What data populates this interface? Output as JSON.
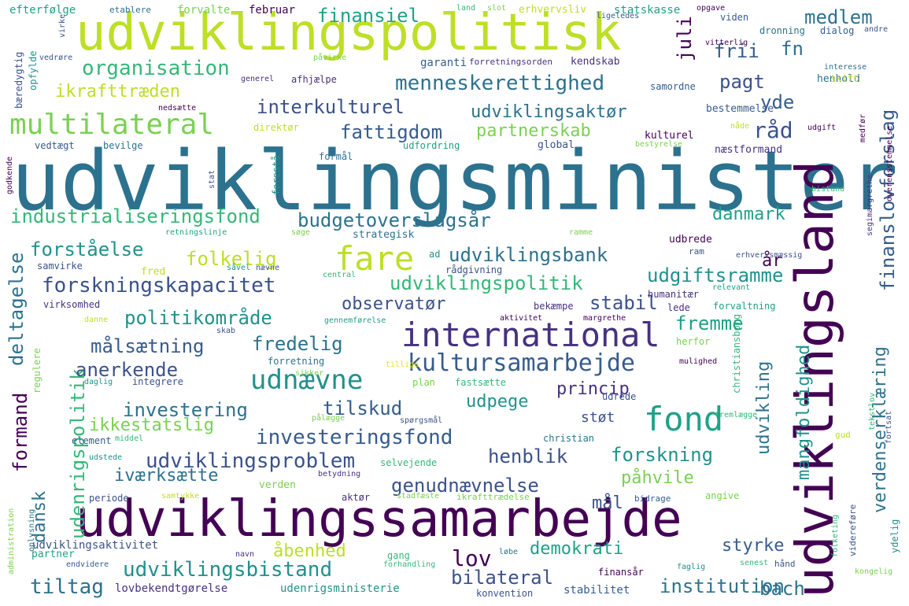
{
  "palette": {
    "dark-purple": "#440154",
    "indigo": "#46327e",
    "blue": "#365c8d",
    "steel": "#3b528b",
    "teal-blue": "#2c728e",
    "teal": "#21918c",
    "sea-green": "#1fa187",
    "green": "#35b779",
    "lime": "#7ad151",
    "yellow-green": "#bddf26",
    "yellow": "#e2e418"
  },
  "words": [
    {
      "text": "udviklingsminister"
    },
    {
      "text": "udviklingssamarbejde"
    },
    {
      "text": "udviklingsland"
    },
    {
      "text": "udviklingspolitisk"
    },
    {
      "text": "international"
    },
    {
      "text": "fond"
    },
    {
      "text": "fare"
    },
    {
      "text": "multilateral"
    },
    {
      "text": "kultursamarbejde"
    },
    {
      "text": "udnævne"
    },
    {
      "text": "finanslovforslag"
    },
    {
      "text": "menneskerettighed"
    },
    {
      "text": "organisation"
    },
    {
      "text": "udviklingspolitik"
    },
    {
      "text": "investeringsfond"
    },
    {
      "text": "udviklingsproblem"
    },
    {
      "text": "industrialiseringsfond"
    },
    {
      "text": "forskningskapacitet"
    },
    {
      "text": "udenrigspolitik"
    },
    {
      "text": "udviklingsbistand"
    },
    {
      "text": "budgetoverslagsår"
    },
    {
      "text": "politikområde"
    },
    {
      "text": "målsætning"
    },
    {
      "text": "investering"
    },
    {
      "text": "forståelse"
    },
    {
      "text": "folkelig"
    },
    {
      "text": "udviklingsbank"
    },
    {
      "text": "fremme"
    },
    {
      "text": "fredelig"
    },
    {
      "text": "tilskud"
    },
    {
      "text": "udgiftsramme"
    },
    {
      "text": "interkulturel"
    },
    {
      "text": "fattigdom"
    },
    {
      "text": "udviklingsaktør"
    },
    {
      "text": "ikrafttræden"
    },
    {
      "text": "råd"
    },
    {
      "text": "verdenserklæring"
    },
    {
      "text": "mangfoldighed"
    },
    {
      "text": "institution"
    },
    {
      "text": "bilateral"
    },
    {
      "text": "tiltag"
    },
    {
      "text": "genudnævnelse"
    },
    {
      "text": "forskning"
    },
    {
      "text": "henblik"
    },
    {
      "text": "lov"
    },
    {
      "text": "bach"
    },
    {
      "text": "medlem"
    },
    {
      "text": "pagt"
    },
    {
      "text": "frii"
    },
    {
      "text": "juli"
    },
    {
      "text": "fn"
    },
    {
      "text": "yde"
    },
    {
      "text": "finansiel"
    },
    {
      "text": "partnerskab"
    },
    {
      "text": "danmark"
    },
    {
      "text": "år"
    },
    {
      "text": "stabil"
    },
    {
      "text": "observatør"
    },
    {
      "text": "anerkende"
    },
    {
      "text": "deltagelse"
    },
    {
      "text": "formand"
    },
    {
      "text": "dansk"
    },
    {
      "text": "ikkestatslig"
    },
    {
      "text": "iværksætte"
    },
    {
      "text": "princip"
    },
    {
      "text": "udpege"
    },
    {
      "text": "udvikling"
    },
    {
      "text": "påhvile"
    },
    {
      "text": "mål"
    },
    {
      "text": "demokrati"
    },
    {
      "text": "styrke"
    },
    {
      "text": "åbenhed"
    },
    {
      "text": "støt"
    },
    {
      "text": "udviklingsaktivitet"
    },
    {
      "text": "udenrigsministerie"
    },
    {
      "text": "lovbekendtgørelse"
    },
    {
      "text": "stabilitet"
    },
    {
      "text": "konvention"
    },
    {
      "text": "efterfølge"
    },
    {
      "text": "etablere"
    },
    {
      "text": "forvalte"
    },
    {
      "text": "februar"
    },
    {
      "text": "erhvervsliv"
    },
    {
      "text": "statskasse"
    },
    {
      "text": "opgave"
    },
    {
      "text": "land"
    },
    {
      "text": "slot"
    },
    {
      "text": "ligeledes"
    },
    {
      "text": "viden"
    },
    {
      "text": "dronning"
    },
    {
      "text": "dialog"
    },
    {
      "text": "andre"
    },
    {
      "text": "vitterlig"
    },
    {
      "text": "vedrøre"
    },
    {
      "text": "påvirke"
    },
    {
      "text": "garanti"
    },
    {
      "text": "forretningsorden"
    },
    {
      "text": "kendskab"
    },
    {
      "text": "henhold"
    },
    {
      "text": "interesse"
    },
    {
      "text": "bæredygtig"
    },
    {
      "text": "opfylde"
    },
    {
      "text": "virke"
    },
    {
      "text": "generel"
    },
    {
      "text": "afhjælpe"
    },
    {
      "text": "samordne"
    },
    {
      "text": "skift"
    },
    {
      "text": "bestemmelse"
    },
    {
      "text": "nedsætte"
    },
    {
      "text": "direktør"
    },
    {
      "text": "kulturel"
    },
    {
      "text": "nåde"
    },
    {
      "text": "udgift"
    },
    {
      "text": "medfør"
    },
    {
      "text": "vedtægt"
    },
    {
      "text": "bevilge"
    },
    {
      "text": "udfordring"
    },
    {
      "text": "global"
    },
    {
      "text": "bestyrelse"
    },
    {
      "text": "næstformand"
    },
    {
      "text": "godkende"
    },
    {
      "text": "formål"
    },
    {
      "text": "forestå"
    },
    {
      "text": "stat"
    },
    {
      "text": "segimargrethe"
    },
    {
      "text": "overensstemmelse"
    },
    {
      "text": "bistand"
    },
    {
      "text": "retningslinje"
    },
    {
      "text": "søge"
    },
    {
      "text": "strategisk"
    },
    {
      "text": "ramme"
    },
    {
      "text": "udbrede"
    },
    {
      "text": "ad"
    },
    {
      "text": "ram"
    },
    {
      "text": "erhvervsmæssig"
    },
    {
      "text": "samvirke"
    },
    {
      "text": "fred"
    },
    {
      "text": "såvel"
    },
    {
      "text": "nævne"
    },
    {
      "text": "central"
    },
    {
      "text": "rådgivning"
    },
    {
      "text": "humanitær"
    },
    {
      "text": "relevant"
    },
    {
      "text": "virksomhed"
    },
    {
      "text": "bekæmpe"
    },
    {
      "text": "lede"
    },
    {
      "text": "forvaltning"
    },
    {
      "text": "danne"
    },
    {
      "text": "gennemførelse"
    },
    {
      "text": "aktivitet"
    },
    {
      "text": "margrethe"
    },
    {
      "text": "skab"
    },
    {
      "text": "herfor"
    },
    {
      "text": "forretning"
    },
    {
      "text": "christiansborg"
    },
    {
      "text": "tillige"
    },
    {
      "text": "mulighed"
    },
    {
      "text": "regulere"
    },
    {
      "text": "daglig"
    },
    {
      "text": "integrere"
    },
    {
      "text": "sikker"
    },
    {
      "text": "plan"
    },
    {
      "text": "fastsætte"
    },
    {
      "text": "udrede"
    },
    {
      "text": "fremlægge"
    },
    {
      "text": "pålægge"
    },
    {
      "text": "tekstlov"
    },
    {
      "text": "spørgsmål"
    },
    {
      "text": "element"
    },
    {
      "text": "middel"
    },
    {
      "text": "christian"
    },
    {
      "text": "gud"
    },
    {
      "text": "fortsat"
    },
    {
      "text": "udstede"
    },
    {
      "text": "selvejende"
    },
    {
      "text": "betydning"
    },
    {
      "text": "verden"
    },
    {
      "text": "administration"
    },
    {
      "text": "periode"
    },
    {
      "text": "samtykke"
    },
    {
      "text": "aktør"
    },
    {
      "text": "stadfæste"
    },
    {
      "text": "ikrafttrædelse"
    },
    {
      "text": "bidrage"
    },
    {
      "text": "angive"
    },
    {
      "text": "oplysning"
    },
    {
      "text": "gang"
    },
    {
      "text": "løbe"
    },
    {
      "text": "folketing"
    },
    {
      "text": "videreføre"
    },
    {
      "text": "ydelig"
    },
    {
      "text": "navn"
    },
    {
      "text": "partner"
    },
    {
      "text": "endvidere"
    },
    {
      "text": "forhandling"
    },
    {
      "text": "finansår"
    },
    {
      "text": "faglig"
    },
    {
      "text": "senest"
    },
    {
      "text": "hånd"
    },
    {
      "text": "kongelig"
    }
  ]
}
